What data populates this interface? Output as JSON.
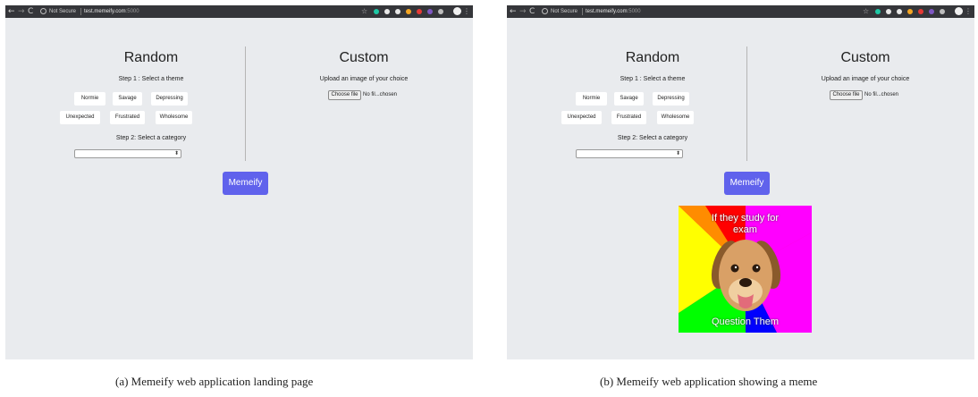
{
  "browser": {
    "nav_back": "←",
    "nav_forward": "→",
    "nav_reload": "C",
    "not_secure": "Not Secure",
    "url_host": "test.memeify.com",
    "url_port": ":5000",
    "bookmark_star": "☆",
    "menu": "⋮",
    "extension_colors": [
      "#1ec8a5",
      "#e8e8e8",
      "#e8e8e8",
      "#f5a623",
      "#e53935",
      "#7e57c2",
      "#bdbdbd"
    ]
  },
  "app": {
    "random_title": "Random",
    "custom_title": "Custom",
    "step1": "Step 1 : Select a theme",
    "step2": "Step 2: Select a category",
    "themes": [
      "Normie",
      "Savage",
      "Depressing",
      "Unexpected",
      "Frustrated",
      "Wholesome"
    ],
    "upload_label": "Upload an image of your choice",
    "choose_file": "Choose file",
    "no_file": "No fil...chosen",
    "select_arrow": "⬍",
    "memeify_button": "Memeify",
    "accent_color": "#6062ec"
  },
  "meme": {
    "top_text": "If they study for exam",
    "bottom_text": "Question Them",
    "background_colors": [
      "#ff0000",
      "#ff00ff",
      "#ffff00",
      "#ff8c00",
      "#00ff00",
      "#0000ff",
      "#ff00aa"
    ],
    "subject_icon": "dog-face-icon"
  },
  "captions": {
    "a": "(a)  Memeify web application landing page",
    "b": "(b)  Memeify web application showing a meme"
  }
}
